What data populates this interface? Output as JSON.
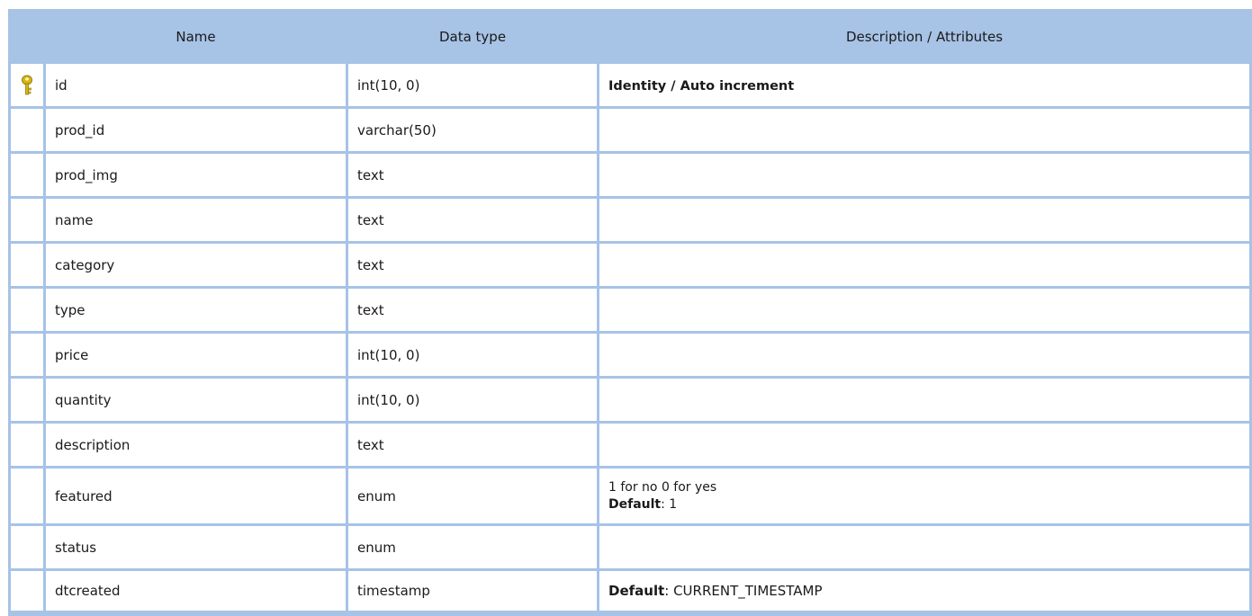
{
  "columns": {
    "name": "Name",
    "data_type": "Data type",
    "description": "Description / Attributes"
  },
  "rows": [
    {
      "name": "id",
      "type": "int(10, 0)",
      "primary_key": true,
      "icon": "key-icon",
      "attr_main": "Identity / Auto increment"
    },
    {
      "name": "prod_id",
      "type": "varchar(50)"
    },
    {
      "name": "prod_img",
      "type": "text"
    },
    {
      "name": "name",
      "type": "text"
    },
    {
      "name": "category",
      "type": "text"
    },
    {
      "name": "type",
      "type": "text"
    },
    {
      "name": "price",
      "type": "int(10, 0)"
    },
    {
      "name": "quantity",
      "type": "int(10, 0)"
    },
    {
      "name": "description",
      "type": "text"
    },
    {
      "name": "featured",
      "type": "enum",
      "attr_note": "1 for no 0 for yes",
      "default_label": "Default",
      "default_value": ": 1"
    },
    {
      "name": "status",
      "type": "enum"
    },
    {
      "name": "dtcreated",
      "type": "timestamp",
      "default_label": "Default",
      "default_value": ": CURRENT_TIMESTAMP"
    }
  ],
  "colors": {
    "header_background": "#a7c3e6",
    "grid_lines": "#a7c3e6",
    "key_icon": "#d6b51a"
  }
}
